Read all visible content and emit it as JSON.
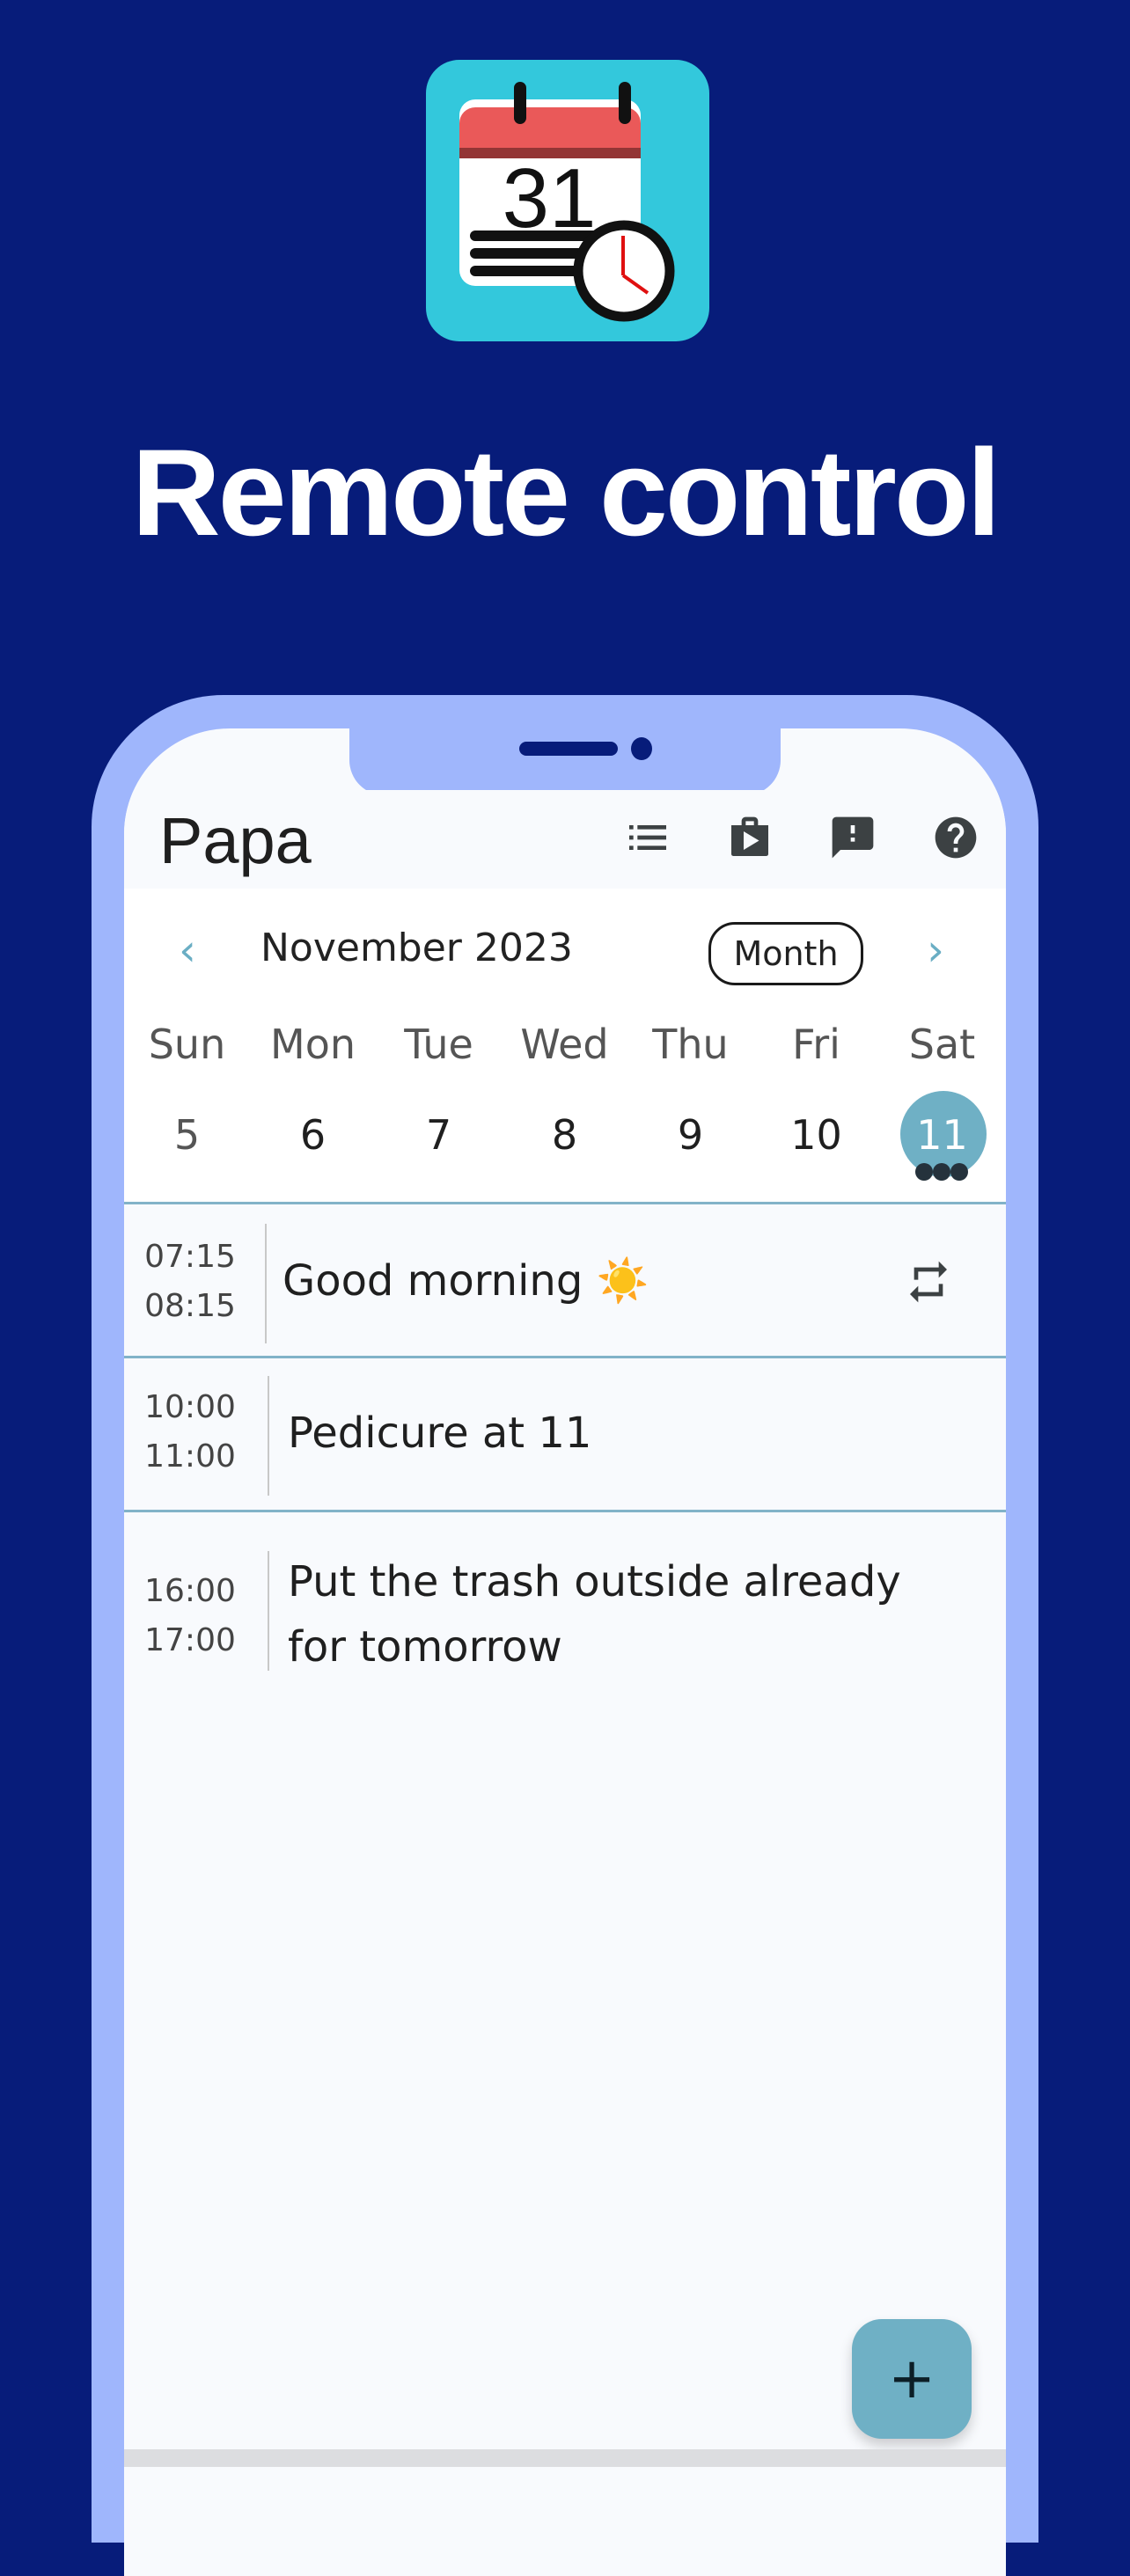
{
  "promo": {
    "headline": "Remote control",
    "app_icon": {
      "name": "calendar-clock-app-icon",
      "calendar_number": "31"
    }
  },
  "colors": {
    "background": "#071c7a",
    "phone_frame": "#9fb6fc",
    "accent": "#6fb0c5",
    "icon_bg": "#33c8dc"
  },
  "header": {
    "title": "Papa",
    "icons": [
      "list-icon",
      "shop-play-icon",
      "feedback-icon",
      "help-icon"
    ]
  },
  "calendar": {
    "prev_label": "‹",
    "next_label": "›",
    "month_label": "November 2023",
    "view_button": "Month",
    "weekdays": [
      "Sun",
      "Mon",
      "Tue",
      "Wed",
      "Thu",
      "Fri",
      "Sat"
    ],
    "dates": [
      "5",
      "6",
      "7",
      "8",
      "9",
      "10",
      "11"
    ],
    "selected_date": "11",
    "selected_event_count": 3
  },
  "events": [
    {
      "start": "07:15",
      "end": "08:15",
      "title": "Good morning ☀️",
      "repeating": true
    },
    {
      "start": "10:00",
      "end": "11:00",
      "title": "Pedicure at 11",
      "repeating": false
    },
    {
      "start": "16:00",
      "end": "17:00",
      "title": "Put the trash outside already for tomorrow",
      "repeating": false
    }
  ],
  "fab": {
    "label": "+"
  }
}
